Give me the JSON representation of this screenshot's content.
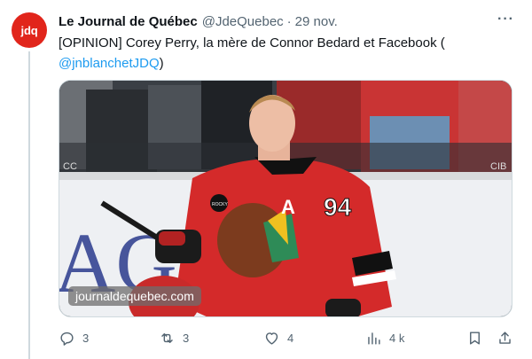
{
  "tweet": {
    "author": {
      "avatar_text": "jdq",
      "name": "Le Journal de Québec",
      "handle": "@JdeQuebec",
      "separator": "·",
      "date": "29 nov."
    },
    "more_label": "···",
    "text_main": "[OPINION] Corey Perry, la mère de Connor Bedard et Facebook (",
    "text_mention": "@jnblanchetJDQ",
    "text_end": ")",
    "media": {
      "watermark": "journaldequebec.com",
      "jersey_number": "94",
      "captain_letter": "A",
      "patch_text": "ROCKY",
      "board_text": "AGEN",
      "board_corner": "CIB",
      "board_corner_left": "CC"
    },
    "actions": {
      "replies": "3",
      "reposts": "3",
      "likes": "4",
      "views": "4 k"
    }
  },
  "colors": {
    "brand": "#e1251b",
    "link": "#1d9bf0",
    "muted": "#536471",
    "jersey": "#d42a2a"
  }
}
